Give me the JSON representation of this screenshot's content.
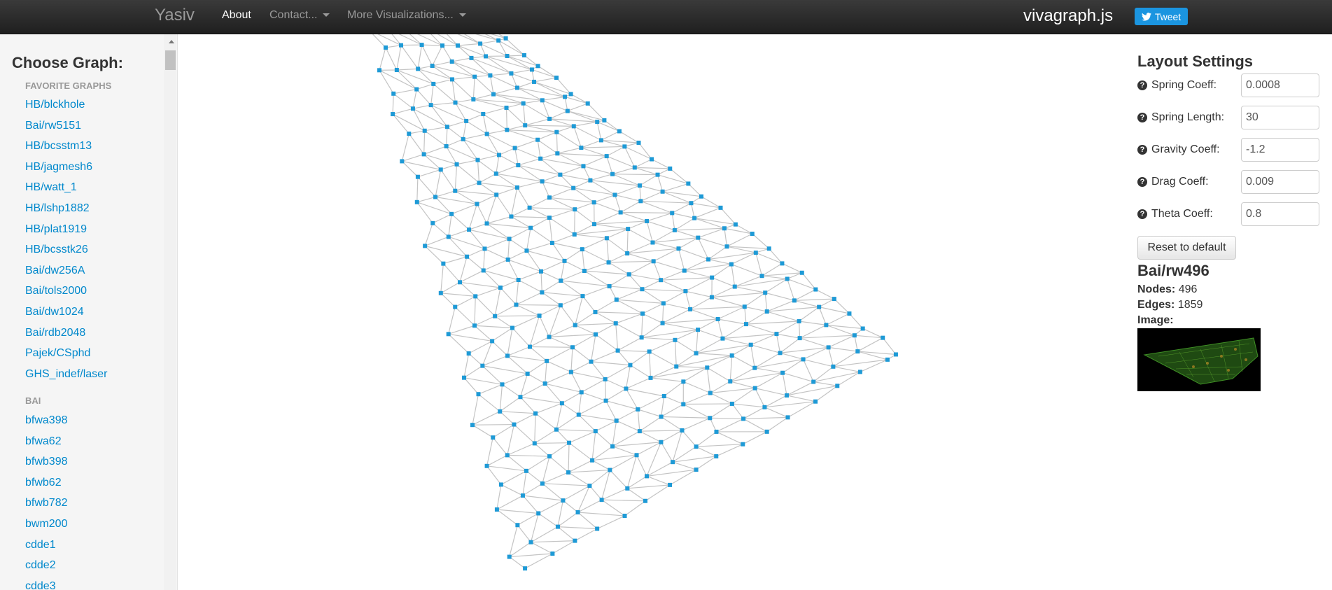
{
  "navbar": {
    "brand": "Yasiv",
    "about": "About",
    "contact": "Contact...",
    "more": "More Visualizations...",
    "app_title": "vivagraph.js",
    "tweet": "Tweet"
  },
  "sidebar": {
    "title": "Choose Graph:",
    "favorites_header": "FAVORITE GRAPHS",
    "favorites": [
      "HB/blckhole",
      "Bai/rw5151",
      "HB/bcsstm13",
      "HB/jagmesh6",
      "HB/watt_1",
      "HB/lshp1882",
      "HB/plat1919",
      "HB/bcsstk26",
      "Bai/dw256A",
      "Bai/tols2000",
      "Bai/dw1024",
      "Bai/rdb2048",
      "Pajek/CSphd",
      "GHS_indef/laser"
    ],
    "bai_header": "BAI",
    "bai": [
      "bfwa398",
      "bfwa62",
      "bfwb398",
      "bfwb62",
      "bfwb782",
      "bwm200",
      "cdde1",
      "cdde2",
      "cdde3"
    ]
  },
  "settings": {
    "title": "Layout Settings",
    "rows": [
      {
        "label": "Spring Coeff:",
        "value": "0.0008"
      },
      {
        "label": "Spring Length:",
        "value": "30"
      },
      {
        "label": "Gravity Coeff:",
        "value": "-1.2"
      },
      {
        "label": "Drag Coeff:",
        "value": "0.009"
      },
      {
        "label": "Theta Coeff:",
        "value": "0.8"
      }
    ],
    "reset": "Reset to default"
  },
  "graph_info": {
    "name": "Bai/rw496",
    "nodes_label": "Nodes:",
    "nodes": "496",
    "edges_label": "Edges:",
    "edges": "1859",
    "image_label": "Image:"
  },
  "colors": {
    "node": "#1e9ad6",
    "edge": "#c4c4c4",
    "link": "#0088cc",
    "tweet": "#1b95e0"
  }
}
